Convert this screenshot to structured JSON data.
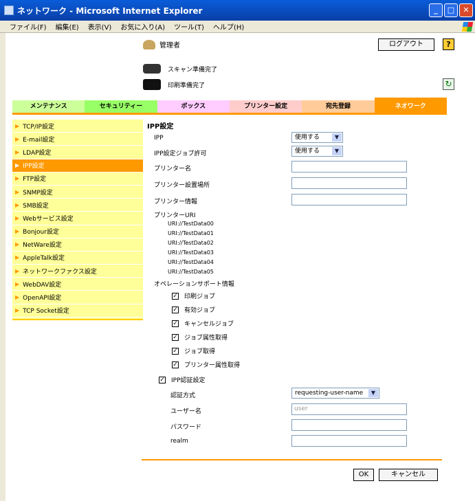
{
  "window": {
    "title": "ネットワーク - Microsoft Internet Explorer"
  },
  "menu": [
    "ファイル(F)",
    "編集(E)",
    "表示(V)",
    "お気に入り(A)",
    "ツール(T)",
    "ヘルプ(H)"
  ],
  "header": {
    "user": "管理者",
    "logout": "ログアウト",
    "help": "?"
  },
  "status": {
    "scan": "スキャン準備完了",
    "print": "印刷準備完了"
  },
  "tabs": [
    {
      "label": "メンテナンス",
      "color": "#ccff99"
    },
    {
      "label": "セキュリティー",
      "color": "#99ff66"
    },
    {
      "label": "ボックス",
      "color": "#ffccff"
    },
    {
      "label": "プリンター設定",
      "color": "#ffcccc"
    },
    {
      "label": "宛先登録",
      "color": "#ffcc99"
    },
    {
      "label": "ネオワーク",
      "color": "#ff9900"
    }
  ],
  "sidebar": [
    "TCP/IP設定",
    "E-mail設定",
    "LDAP設定",
    "IPP設定",
    "FTP設定",
    "SNMP設定",
    "SMB設定",
    "Webサービス設定",
    "Bonjour設定",
    "NetWare設定",
    "AppleTalk設定",
    "ネットワークファクス設定",
    "WebDAV設定",
    "OpenAPI設定",
    "TCP Socket設定"
  ],
  "form": {
    "title": "IPP設定",
    "ipp_label": "IPP",
    "ipp_value": "使用する",
    "job_label": "IPP設定ジョブ許可",
    "job_value": "使用する",
    "printer_name": "プリンター名",
    "printer_location": "プリンター設置場所",
    "printer_info": "プリンター情報",
    "printer_uri": "プリンターURI",
    "uris": [
      "URI://TestData00",
      "URI://TestData01",
      "URI://TestData02",
      "URI://TestData03",
      "URI://TestData04",
      "URI://TestData05"
    ],
    "op_support": "オペレーションサポート情報",
    "ops": [
      "印刷ジョブ",
      "有効ジョブ",
      "キャンセルジョブ",
      "ジョブ属性取得",
      "ジョブ取得",
      "プリンター属性取得"
    ],
    "auth_setting": "IPP認証設定",
    "auth_method_label": "認証方式",
    "auth_method_value": "requesting-user-name",
    "username_label": "ユーザー名",
    "username_placeholder": "user",
    "password_label": "パスワード",
    "realm_label": "realm"
  },
  "buttons": {
    "ok": "OK",
    "cancel": "キャンセル"
  }
}
